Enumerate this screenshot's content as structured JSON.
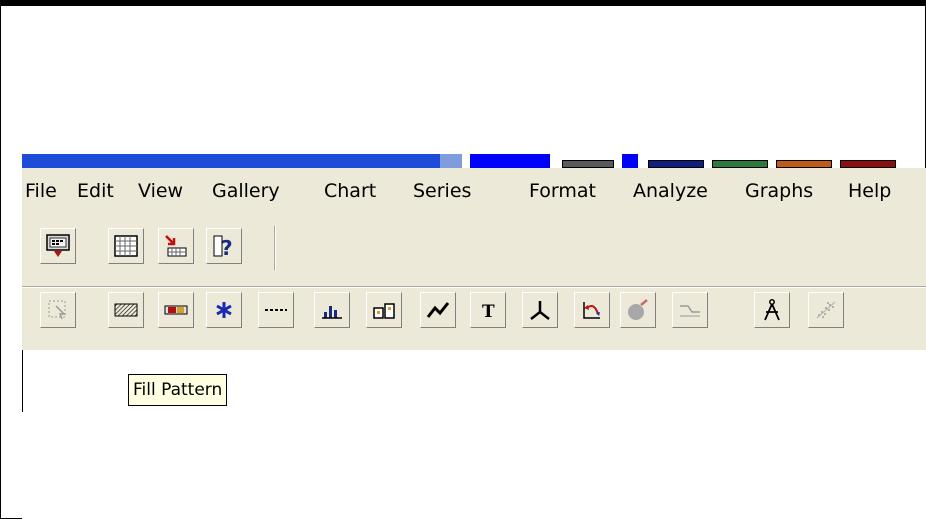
{
  "window": {
    "title_strip_colors": [
      "#1c4cd8",
      "#7f9ddc",
      "#0000ff",
      "#5a5a5a",
      "#0000ff",
      "#102080",
      "#2e7a3a",
      "#c05a1a",
      "#8a1010"
    ]
  },
  "menubar": {
    "items": [
      "File",
      "Edit",
      "View",
      "Gallery",
      "Chart",
      "Series",
      "Format",
      "Analyze",
      "Graphs",
      "Help"
    ]
  },
  "toolbar1": {
    "buttons": [
      {
        "icon": "monitor-export-icon"
      },
      {
        "icon": "data-grid-icon"
      },
      {
        "icon": "import-data-icon"
      },
      {
        "icon": "context-help-icon"
      }
    ]
  },
  "toolbar2": {
    "buttons": [
      {
        "icon": "select-object-icon",
        "enabled": false
      },
      {
        "icon": "fill-pattern-icon",
        "enabled": true
      },
      {
        "icon": "color-bar-icon",
        "enabled": true
      },
      {
        "icon": "point-marker-icon",
        "enabled": true
      },
      {
        "icon": "line-style-icon",
        "enabled": true
      },
      {
        "icon": "bar-chart-icon",
        "enabled": true
      },
      {
        "icon": "gallery-icon",
        "enabled": true
      },
      {
        "icon": "line-chart-icon",
        "enabled": true
      },
      {
        "icon": "text-icon",
        "enabled": true
      },
      {
        "icon": "axes-icon",
        "enabled": true
      },
      {
        "icon": "rotate-icon",
        "enabled": true
      },
      {
        "icon": "3d-effect-icon",
        "enabled": false
      },
      {
        "icon": "smooth-curve-icon",
        "enabled": false
      },
      {
        "icon": "compass-tool-icon",
        "enabled": true
      },
      {
        "icon": "scatter-fit-icon",
        "enabled": false
      }
    ]
  },
  "tooltip": {
    "text": "Fill Pattern"
  }
}
